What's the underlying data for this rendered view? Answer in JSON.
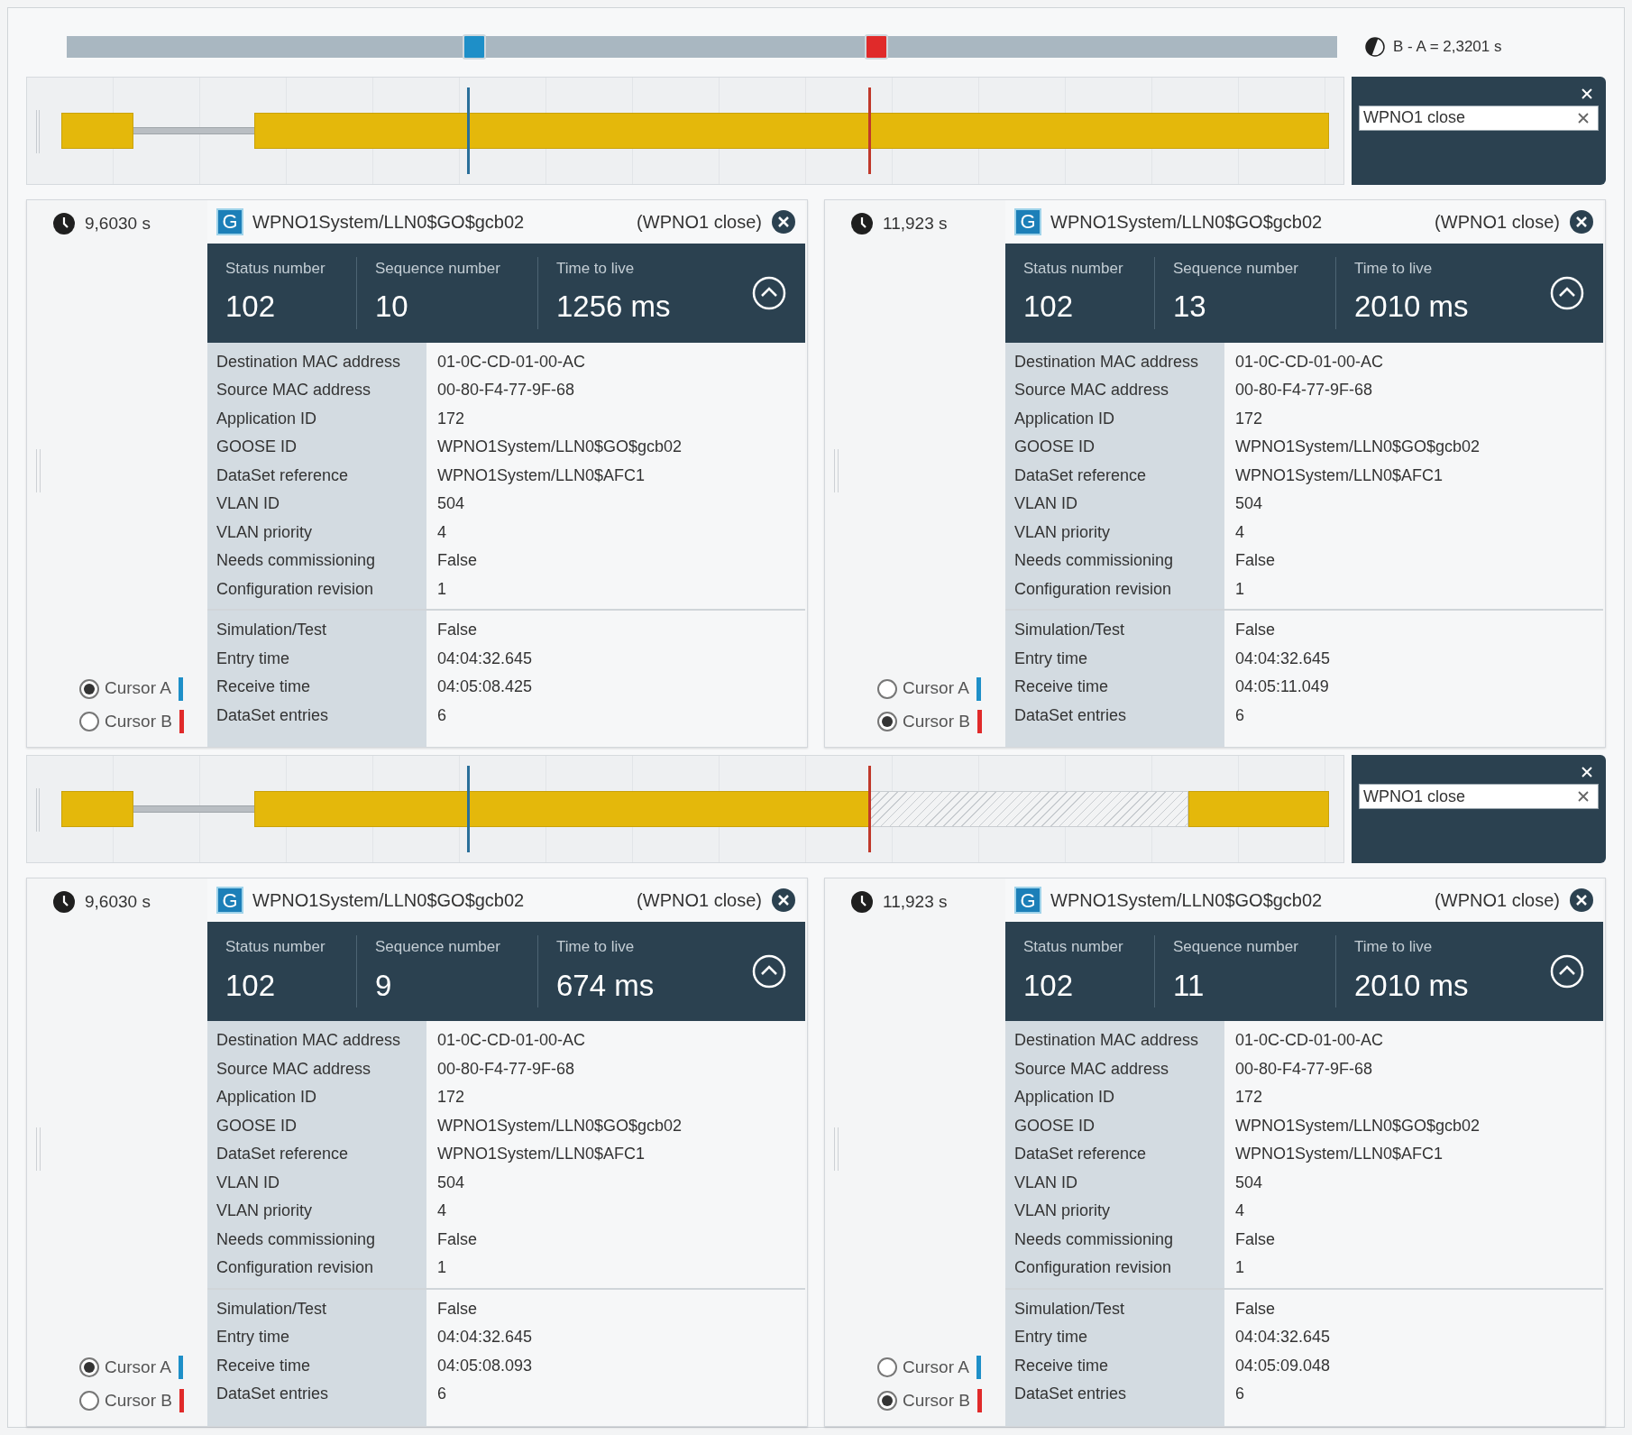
{
  "scrubber": {
    "handles": [
      {
        "level": 0.321,
        "color": "#1e8fc8"
      },
      {
        "level": 0.637,
        "color": "#e02a2a"
      }
    ],
    "difference": "B - A = 2,3201 s"
  },
  "sections": [
    {
      "timeline": {
        "segments": [
          {
            "kind": "active"
          },
          {
            "kind": "gap"
          },
          {
            "kind": "active"
          }
        ],
        "cursors": [
          {
            "level": 0.321,
            "color": "#2a6f9a"
          },
          {
            "level": 0.637,
            "color": "#c0392b"
          }
        ]
      },
      "filter": {
        "value": "WPNO1 close"
      },
      "panels": [
        {
          "time": "9,6030 s",
          "cursors": [
            {
              "label": "Cursor A",
              "selected": true,
              "color": "#1e8fc8"
            },
            {
              "label": "Cursor B",
              "selected": false,
              "color": "#e02a2a"
            }
          ],
          "badge": "G",
          "title": "WPNO1System/LLN0$GO$gcb02",
          "tag": "(WPNO1 close)",
          "stats": [
            {
              "label": "Status number",
              "value": "102"
            },
            {
              "label": "Sequence number",
              "value": "10"
            },
            {
              "label": "Time to live",
              "value": "1256 ms"
            }
          ],
          "groups": [
            [
              [
                "Destination MAC address",
                "01-0C-CD-01-00-AC"
              ],
              [
                "Source MAC address",
                "00-80-F4-77-9F-68"
              ],
              [
                "Application ID",
                "172"
              ],
              [
                "GOOSE ID",
                "WPNO1System/LLN0$GO$gcb02"
              ],
              [
                "DataSet reference",
                "WPNO1System/LLN0$AFC1"
              ],
              [
                "VLAN ID",
                "504"
              ],
              [
                "VLAN priority",
                "4"
              ],
              [
                "Needs commissioning",
                "False"
              ],
              [
                "Configuration revision",
                "1"
              ]
            ],
            [
              [
                "Simulation/Test",
                "False"
              ],
              [
                "Entry time",
                "04:04:32.645"
              ],
              [
                "Receive time",
                "04:05:08.425"
              ],
              [
                "DataSet entries",
                "6"
              ]
            ]
          ]
        },
        {
          "time": "11,923 s",
          "cursors": [
            {
              "label": "Cursor A",
              "selected": false,
              "color": "#1e8fc8"
            },
            {
              "label": "Cursor B",
              "selected": true,
              "color": "#e02a2a"
            }
          ],
          "badge": "G",
          "title": "WPNO1System/LLN0$GO$gcb02",
          "tag": "(WPNO1 close)",
          "stats": [
            {
              "label": "Status number",
              "value": "102"
            },
            {
              "label": "Sequence number",
              "value": "13"
            },
            {
              "label": "Time to live",
              "value": "2010 ms"
            }
          ],
          "groups": [
            [
              [
                "Destination MAC address",
                "01-0C-CD-01-00-AC"
              ],
              [
                "Source MAC address",
                "00-80-F4-77-9F-68"
              ],
              [
                "Application ID",
                "172"
              ],
              [
                "GOOSE ID",
                "WPNO1System/LLN0$GO$gcb02"
              ],
              [
                "DataSet reference",
                "WPNO1System/LLN0$AFC1"
              ],
              [
                "VLAN ID",
                "504"
              ],
              [
                "VLAN priority",
                "4"
              ],
              [
                "Needs commissioning",
                "False"
              ],
              [
                "Configuration revision",
                "1"
              ]
            ],
            [
              [
                "Simulation/Test",
                "False"
              ],
              [
                "Entry time",
                "04:04:32.645"
              ],
              [
                "Receive time",
                "04:05:11.049"
              ],
              [
                "DataSet entries",
                "6"
              ]
            ]
          ]
        }
      ]
    },
    {
      "timeline": {
        "segments": [
          {
            "kind": "active"
          },
          {
            "kind": "gap"
          },
          {
            "kind": "active"
          },
          {
            "kind": "hatched"
          },
          {
            "kind": "active"
          }
        ],
        "cursors": [
          {
            "level": 0.321,
            "color": "#2a6f9a"
          },
          {
            "level": 0.637,
            "color": "#c0392b"
          }
        ]
      },
      "filter": {
        "value": "WPNO1 close"
      },
      "panels": [
        {
          "time": "9,6030 s",
          "cursors": [
            {
              "label": "Cursor A",
              "selected": true,
              "color": "#1e8fc8"
            },
            {
              "label": "Cursor B",
              "selected": false,
              "color": "#e02a2a"
            }
          ],
          "badge": "G",
          "title": "WPNO1System/LLN0$GO$gcb02",
          "tag": "(WPNO1 close)",
          "stats": [
            {
              "label": "Status number",
              "value": "102"
            },
            {
              "label": "Sequence number",
              "value": "9"
            },
            {
              "label": "Time to live",
              "value": "674 ms"
            }
          ],
          "groups": [
            [
              [
                "Destination MAC address",
                "01-0C-CD-01-00-AC"
              ],
              [
                "Source MAC address",
                "00-80-F4-77-9F-68"
              ],
              [
                "Application ID",
                "172"
              ],
              [
                "GOOSE ID",
                "WPNO1System/LLN0$GO$gcb02"
              ],
              [
                "DataSet reference",
                "WPNO1System/LLN0$AFC1"
              ],
              [
                "VLAN ID",
                "504"
              ],
              [
                "VLAN priority",
                "4"
              ],
              [
                "Needs commissioning",
                "False"
              ],
              [
                "Configuration revision",
                "1"
              ]
            ],
            [
              [
                "Simulation/Test",
                "False"
              ],
              [
                "Entry time",
                "04:04:32.645"
              ],
              [
                "Receive time",
                "04:05:08.093"
              ],
              [
                "DataSet entries",
                "6"
              ]
            ]
          ]
        },
        {
          "time": "11,923 s",
          "cursors": [
            {
              "label": "Cursor A",
              "selected": false,
              "color": "#1e8fc8"
            },
            {
              "label": "Cursor B",
              "selected": true,
              "color": "#e02a2a"
            }
          ],
          "badge": "G",
          "title": "WPNO1System/LLN0$GO$gcb02",
          "tag": "(WPNO1 close)",
          "stats": [
            {
              "label": "Status number",
              "value": "102"
            },
            {
              "label": "Sequence number",
              "value": "11"
            },
            {
              "label": "Time to live",
              "value": "2010 ms"
            }
          ],
          "groups": [
            [
              [
                "Destination MAC address",
                "01-0C-CD-01-00-AC"
              ],
              [
                "Source MAC address",
                "00-80-F4-77-9F-68"
              ],
              [
                "Application ID",
                "172"
              ],
              [
                "GOOSE ID",
                "WPNO1System/LLN0$GO$gcb02"
              ],
              [
                "DataSet reference",
                "WPNO1System/LLN0$AFC1"
              ],
              [
                "VLAN ID",
                "504"
              ],
              [
                "VLAN priority",
                "4"
              ],
              [
                "Needs commissioning",
                "False"
              ],
              [
                "Configuration revision",
                "1"
              ]
            ],
            [
              [
                "Simulation/Test",
                "False"
              ],
              [
                "Entry time",
                "04:04:32.645"
              ],
              [
                "Receive time",
                "04:05:09.048"
              ],
              [
                "DataSet entries",
                "6"
              ]
            ]
          ]
        }
      ]
    }
  ]
}
